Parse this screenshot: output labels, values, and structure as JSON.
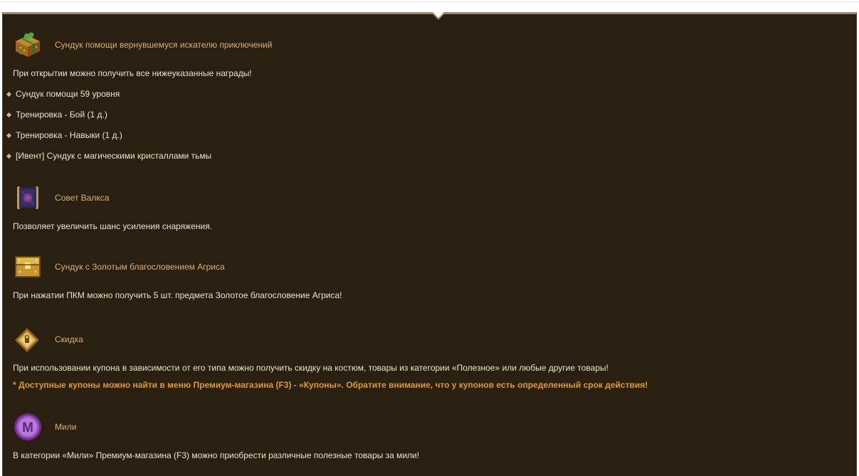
{
  "items": [
    {
      "icon": "gift-chest-icon",
      "title": "Сундук помощи вернувшемуся искателю приключений",
      "desc": "При открытии можно получить все нижеуказанные награды!",
      "bullets": [
        "Сундук помощи 59 уровня",
        "Тренировка - Бой (1 д.)",
        "Тренировка - Навыки (1 д.)",
        "[Ивент] Сундук с магическими кристаллами тьмы"
      ]
    },
    {
      "icon": "scroll-icon",
      "title": "Совет Валкса",
      "desc": "Позволяет увеличить шанс усиления снаряжения."
    },
    {
      "icon": "golden-chest-icon",
      "title": "Сундук с Золотым благословением Агриса",
      "desc": "При нажатии ПКМ можно получить 5 шт. предмета Золотое благословение Агриса!"
    },
    {
      "icon": "coupon-icon",
      "title": "Скидка",
      "desc": "При использовании купона в зависимости от его типа можно получить скидку на костюм, товары из категории «Полезное» или любые другие товары!",
      "note": "* Доступные купоны можно найти в меню Премиум-магазина (F3) - «Купоны». Обратите внимание, что у купонов есть определенный срок действия!"
    },
    {
      "icon": "miles-coin-icon",
      "icon_letter": "M",
      "title": "Мили",
      "desc": "В категории «Мили» Премиум-магазина (F3) можно приобрести различные полезные товары за мили!"
    }
  ],
  "colors": {
    "panel_bg": "#2a2012",
    "title": "#d7b271",
    "text": "#ece3cc",
    "warning": "#e29a1f",
    "border": "#a08a65"
  }
}
